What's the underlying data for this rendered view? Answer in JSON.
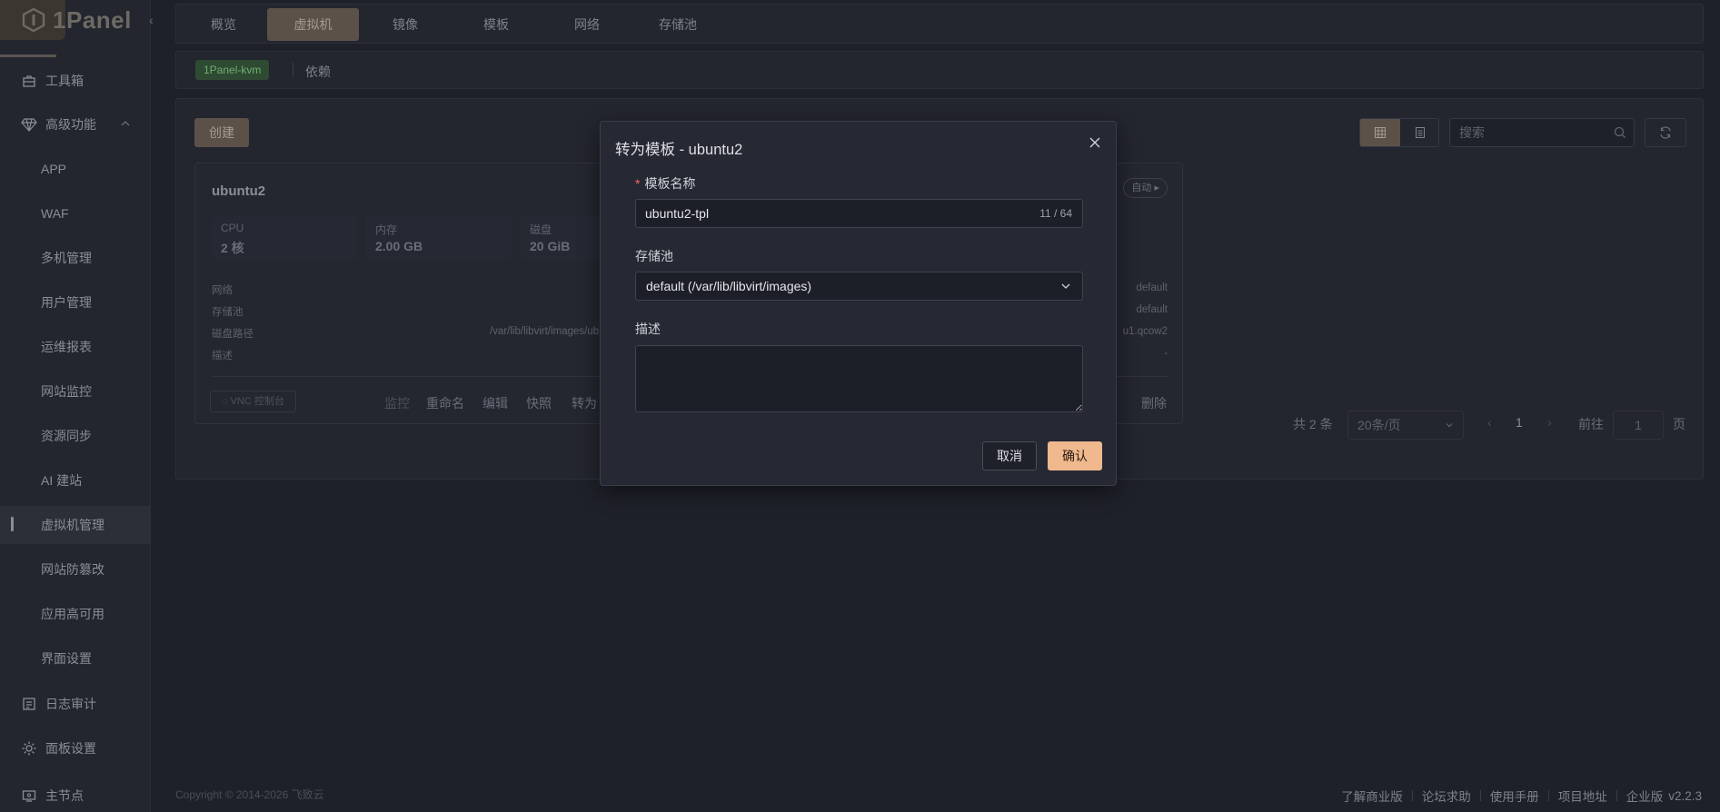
{
  "brand": {
    "name": "1Panel"
  },
  "sidebar": {
    "items": [
      {
        "label": "工具箱",
        "icon": "toolbox-icon"
      },
      {
        "label": "高级功能",
        "icon": "diamond-icon"
      },
      {
        "label": "APP"
      },
      {
        "label": "WAF"
      },
      {
        "label": "多机管理"
      },
      {
        "label": "用户管理"
      },
      {
        "label": "运维报表"
      },
      {
        "label": "网站监控"
      },
      {
        "label": "资源同步"
      },
      {
        "label": "AI 建站"
      },
      {
        "label": "虚拟机管理"
      },
      {
        "label": "网站防篡改"
      },
      {
        "label": "应用高可用"
      },
      {
        "label": "界面设置"
      },
      {
        "label": "日志审计",
        "icon": "log-audit-icon"
      },
      {
        "label": "面板设置",
        "icon": "gear-icon"
      },
      {
        "label": "主节点",
        "icon": "node-icon"
      }
    ]
  },
  "tabs": [
    "概览",
    "虚拟机",
    "镜像",
    "模板",
    "网络",
    "存储池"
  ],
  "subbar": {
    "tag": "1Panel-kvm",
    "dep_link": "依赖"
  },
  "toolbar": {
    "create": "创建",
    "search_placeholder": "搜索"
  },
  "vm": {
    "name": "ubuntu2",
    "status": "自动",
    "stats": [
      {
        "key": "CPU",
        "value": "2 核"
      },
      {
        "key": "内存",
        "value": "2.00 GB"
      },
      {
        "key": "磁盘",
        "value": "20 GiB"
      }
    ],
    "rows": [
      {
        "key": "网络",
        "mid": "",
        "value": "default"
      },
      {
        "key": "存储池",
        "mid": "",
        "value": "default"
      },
      {
        "key": "磁盘路径",
        "mid": "/var/lib/libvirt/images/ub",
        "value": "u1.qcow2"
      },
      {
        "key": "描述",
        "mid": "",
        "value": "-"
      }
    ],
    "vnc": "VNC 控制台",
    "actions": [
      "监控",
      "重命名",
      "编辑",
      "快照",
      "转为"
    ],
    "delete": "删除"
  },
  "pagination": {
    "total": "共 2 条",
    "page_size": "20条/页",
    "current": "1",
    "goto_label": "前往",
    "goto_value": "1",
    "page_suffix": "页"
  },
  "footer": {
    "copyright": "Copyright © 2014-2026 飞致云",
    "links": [
      "了解商业版",
      "论坛求助",
      "使用手册",
      "项目地址",
      "企业版"
    ],
    "version": "v2.2.3"
  },
  "dialog": {
    "title": "转为模板 - ubuntu2",
    "name_label": "模板名称",
    "name_value": "ubuntu2-tpl",
    "name_counter": "11 / 64",
    "pool_label": "存储池",
    "pool_value": "default (/var/lib/libvirt/images)",
    "desc_label": "描述",
    "desc_value": "",
    "cancel": "取消",
    "confirm": "确认"
  },
  "colors": {
    "accent": "#f0b88d",
    "required": "#f56c6c",
    "tag_green": "#6fae6f"
  }
}
